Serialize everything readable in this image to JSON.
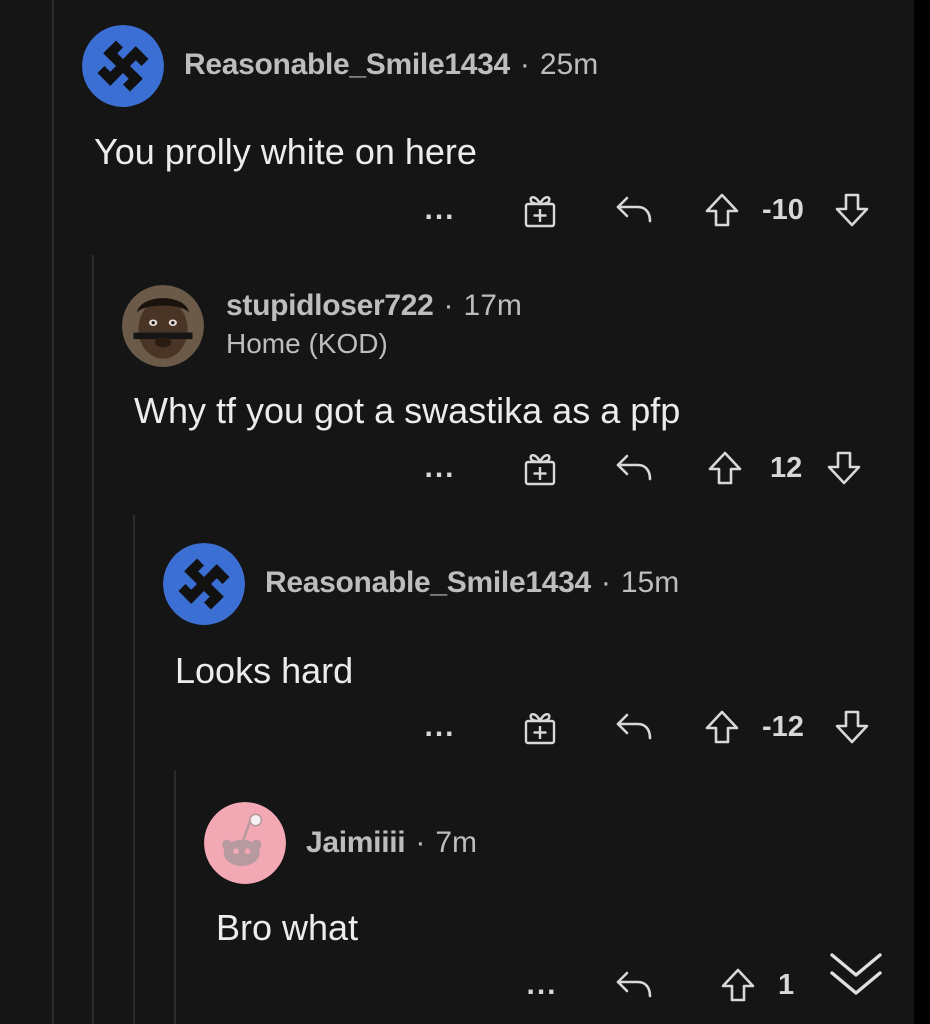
{
  "comments": [
    {
      "username": "Reasonable_Smile1434",
      "separator": "·",
      "time": "25m",
      "avatar_icon": "swastika-avatar-icon",
      "body": "You prolly white on here",
      "score": "-10"
    },
    {
      "username": "stupidloser722",
      "separator": "·",
      "time": "17m",
      "flair": "Home (KOD)",
      "avatar_icon": "photo-avatar-icon",
      "body": "Why tf you got a swastika as a pfp",
      "score": "12"
    },
    {
      "username": "Reasonable_Smile1434",
      "separator": "·",
      "time": "15m",
      "avatar_icon": "swastika-avatar-icon",
      "body": "Looks hard",
      "score": "-12"
    },
    {
      "username": "Jaimiiii",
      "separator": "·",
      "time": "7m",
      "avatar_icon": "snoo-avatar-icon",
      "body": "Bro what",
      "score": "1"
    }
  ],
  "actions": {
    "more_label": "...",
    "icons": [
      "more-options-icon",
      "award-icon",
      "reply-icon",
      "upvote-icon",
      "downvote-icon",
      "collapse-thread-icon"
    ]
  },
  "colors": {
    "background": "#151515",
    "text": "#ececec",
    "meta": "#bdbdbd",
    "avatar_blue": "#3b6fd4",
    "snoo_pink": "#f2a9b3",
    "thread_line": "#2b2b2b"
  }
}
